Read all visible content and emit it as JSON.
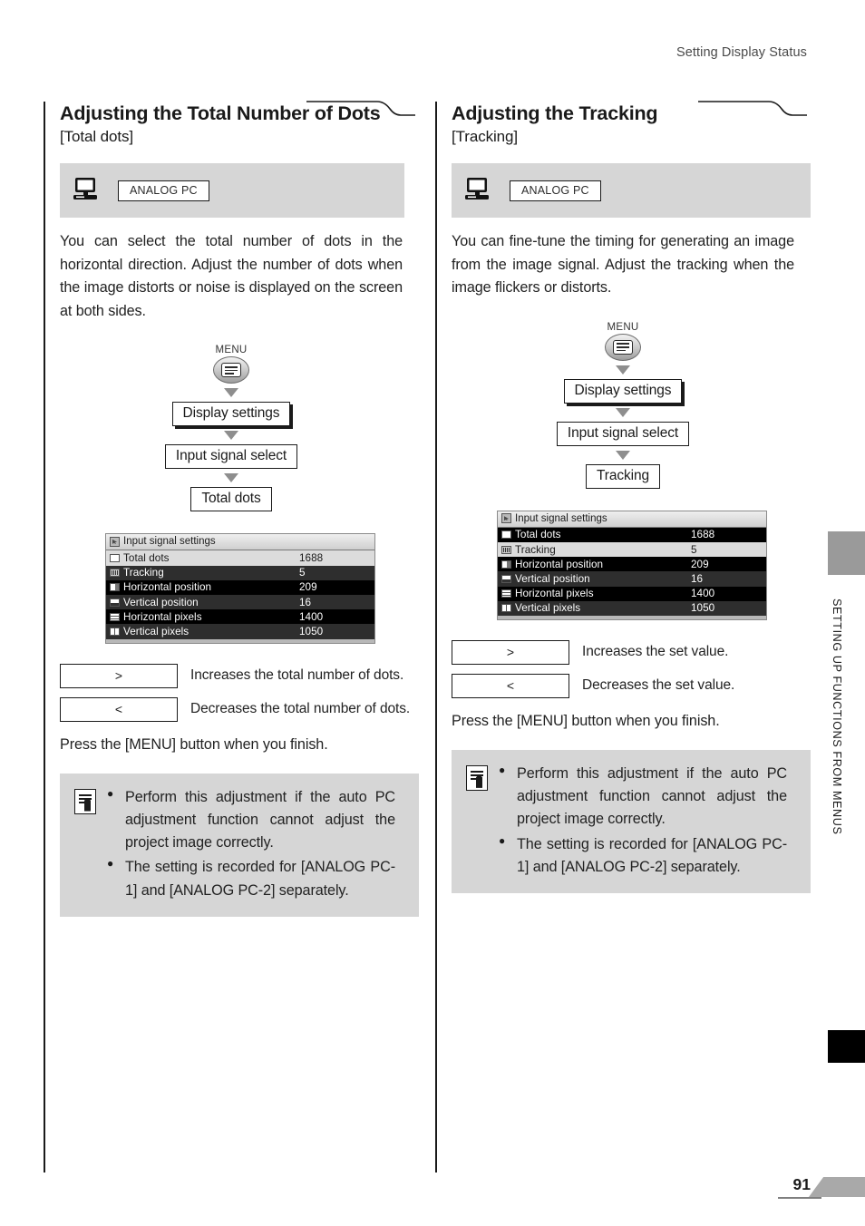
{
  "header": {
    "running_title": "Setting Display Status"
  },
  "side": {
    "vertical_text": "SETTING UP FUNCTIONS FROM MENUS"
  },
  "footer": {
    "page_number": "91"
  },
  "columns": [
    {
      "title": "Adjusting the Total Number of Dots",
      "subtitle": "[Total dots]",
      "signal_band": {
        "icon": "monitor-icon",
        "chip_label": "ANALOG PC"
      },
      "body": "You can select the total number of dots in the horizontal direction. Adjust the number of dots when the image distorts or noise is displayed on the screen at both sides.",
      "flow": {
        "button_label": "MENU",
        "button_icon": "menu-list-icon",
        "steps": [
          "Display settings",
          "Input signal select",
          "Total dots"
        ]
      },
      "osd": {
        "title": "Input signal settings",
        "title_icon": "signal-icon",
        "selected_row": 0,
        "rows": [
          {
            "icon": "total-dots-icon",
            "label": "Total dots",
            "value": "1688"
          },
          {
            "icon": "tracking-icon",
            "label": "Tracking",
            "value": "5"
          },
          {
            "icon": "horizontal-position-icon",
            "label": "Horizontal position",
            "value": "209"
          },
          {
            "icon": "vertical-position-icon",
            "label": "Vertical position",
            "value": "16"
          },
          {
            "icon": "horizontal-pixels-icon",
            "label": "Horizontal pixels",
            "value": "1400"
          },
          {
            "icon": "vertical-pixels-icon",
            "label": "Vertical pixels",
            "value": "1050"
          }
        ]
      },
      "keys": [
        {
          "key": ">",
          "desc": "Increases the total number of dots."
        },
        {
          "key": "<",
          "desc": "Decreases the total number of dots."
        }
      ],
      "press_line": "Press the [MENU] button when you finish.",
      "note": {
        "icon": "memo-pencil-icon",
        "bullets": [
          "Perform this adjustment if the auto PC adjustment function cannot adjust the project image correctly.",
          "The setting is recorded for [ANALOG PC-1] and [ANALOG PC-2] separately."
        ]
      }
    },
    {
      "title": "Adjusting the Tracking",
      "subtitle": "[Tracking]",
      "signal_band": {
        "icon": "monitor-icon",
        "chip_label": "ANALOG PC"
      },
      "body": "You can fine-tune the timing for generating an image from the image signal. Adjust the tracking when the image flickers or distorts.",
      "flow": {
        "button_label": "MENU",
        "button_icon": "menu-list-icon",
        "steps": [
          "Display settings",
          "Input signal select",
          "Tracking"
        ]
      },
      "osd": {
        "title": "Input signal settings",
        "title_icon": "signal-icon",
        "selected_row": 1,
        "rows": [
          {
            "icon": "total-dots-icon",
            "label": "Total dots",
            "value": "1688"
          },
          {
            "icon": "tracking-icon",
            "label": "Tracking",
            "value": "5"
          },
          {
            "icon": "horizontal-position-icon",
            "label": "Horizontal position",
            "value": "209"
          },
          {
            "icon": "vertical-position-icon",
            "label": "Vertical position",
            "value": "16"
          },
          {
            "icon": "horizontal-pixels-icon",
            "label": "Horizontal pixels",
            "value": "1400"
          },
          {
            "icon": "vertical-pixels-icon",
            "label": "Vertical pixels",
            "value": "1050"
          }
        ]
      },
      "keys": [
        {
          "key": ">",
          "desc": "Increases the set value."
        },
        {
          "key": "<",
          "desc": "Decreases the set value."
        }
      ],
      "press_line": "Press the [MENU] button when you finish.",
      "note": {
        "icon": "memo-pencil-icon",
        "bullets": [
          "Perform this adjustment if the auto PC adjustment function cannot adjust the project image correctly.",
          "The setting is recorded for [ANALOG PC-1] and [ANALOG PC-2] separately."
        ]
      }
    }
  ],
  "colors": {
    "band_gray": "#d6d6d6",
    "tab_gray": "#9a9a9a",
    "tab_black": "#000000",
    "osd_selected": "#dcdcdc",
    "text": "#1a1a1a"
  }
}
